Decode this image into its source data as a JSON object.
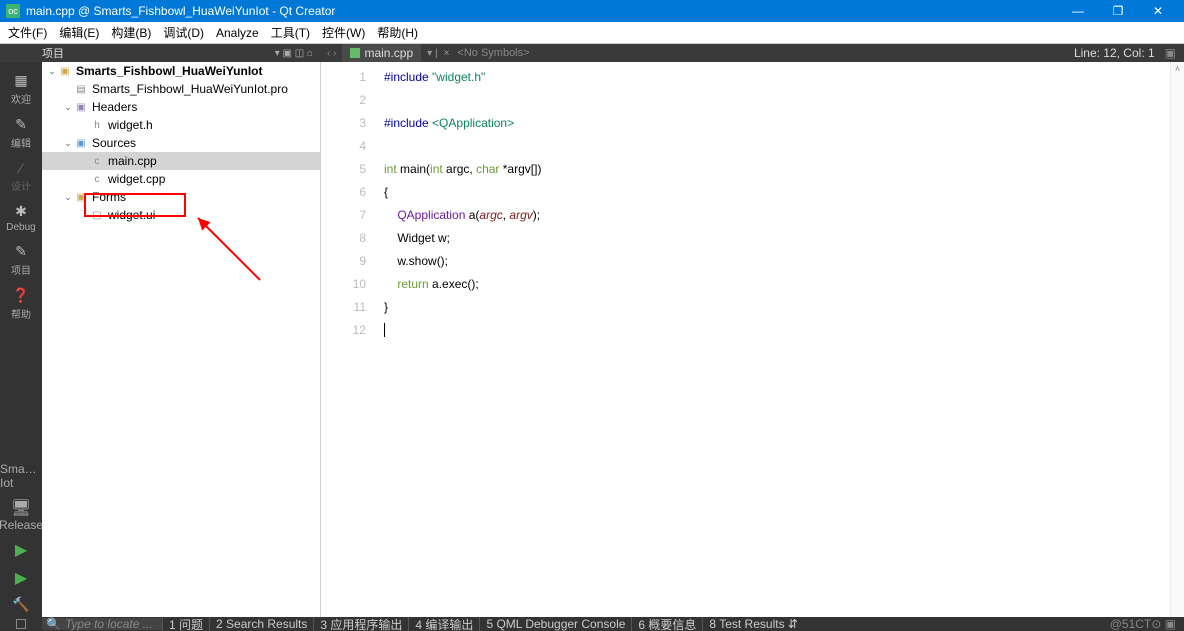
{
  "title": "main.cpp @ Smarts_Fishbowl_HuaWeiYunIot - Qt Creator",
  "menu": [
    "文件(F)",
    "编辑(E)",
    "构建(B)",
    "调试(D)",
    "Analyze",
    "工具(T)",
    "控件(W)",
    "帮助(H)"
  ],
  "toolbar": {
    "project_label": "项目",
    "filter_glyphs": "▾ ▣ ◫ ⌂",
    "nav_glyphs": "‹ ›",
    "open_doc": "main.cpp",
    "close_glyph": "×",
    "symbols": "<No Symbols>",
    "line_col": "Line: 12, Col: 1",
    "rightglyph": "▣"
  },
  "sidebar": {
    "items": [
      {
        "icon": "▦",
        "label": "欢迎"
      },
      {
        "icon": "✎",
        "label": "编辑"
      },
      {
        "icon": "∕",
        "label": "设计"
      },
      {
        "icon": "✱",
        "label": "Debug"
      },
      {
        "icon": "✎",
        "label": "项目"
      },
      {
        "icon": "❓",
        "label": "帮助"
      }
    ],
    "bottom": {
      "kit": "Sma…Iot",
      "monitor": "🖥",
      "release": "Release",
      "run": "▶",
      "run_bug": "▶",
      "build": "🔨"
    }
  },
  "tree": {
    "project": "Smarts_Fishbowl_HuaWeiYunIot",
    "pro_file": "Smarts_Fishbowl_HuaWeiYunIot.pro",
    "headers": "Headers",
    "widget_h": "widget.h",
    "sources": "Sources",
    "main_cpp": "main.cpp",
    "widget_cpp": "widget.cpp",
    "forms": "Forms",
    "widget_ui": "widget.ui"
  },
  "code": {
    "l1": {
      "a": "#include ",
      "b": "\"widget.h\""
    },
    "l2": "",
    "l3": {
      "a": "#include ",
      "b": "<QApplication>"
    },
    "l4": "",
    "l5": {
      "a": "int",
      "b": " main(",
      "c": "int",
      "d": " argc, ",
      "e": "char",
      "f": " *argv[])"
    },
    "l6": "{",
    "l7": {
      "a": "    ",
      "b": "QApplication",
      "c": " a(",
      "d": "argc",
      "e": ", ",
      "f": "argv",
      "g": ");"
    },
    "l8": {
      "a": "    Widget w;"
    },
    "l9": {
      "a": "    w.show();"
    },
    "l10": {
      "a": "    ",
      "b": "return",
      "c": " a.exec();"
    },
    "l11": "}",
    "l12": ""
  },
  "line_numbers": [
    "1",
    "2",
    "3",
    "4",
    "5",
    "6",
    "7",
    "8",
    "9",
    "10",
    "11",
    "12"
  ],
  "footer": {
    "search_placeholder": "Type to locate ...",
    "items": [
      "1 问题",
      "2 Search Results",
      "3 应用程序输出",
      "4 编译输出",
      "5 QML Debugger Console",
      "6 概要信息",
      "8 Test Results  ⇵"
    ],
    "right": "@51CT⊙ ▣"
  },
  "window_controls": {
    "min": "—",
    "max": "❐",
    "close": "✕"
  }
}
